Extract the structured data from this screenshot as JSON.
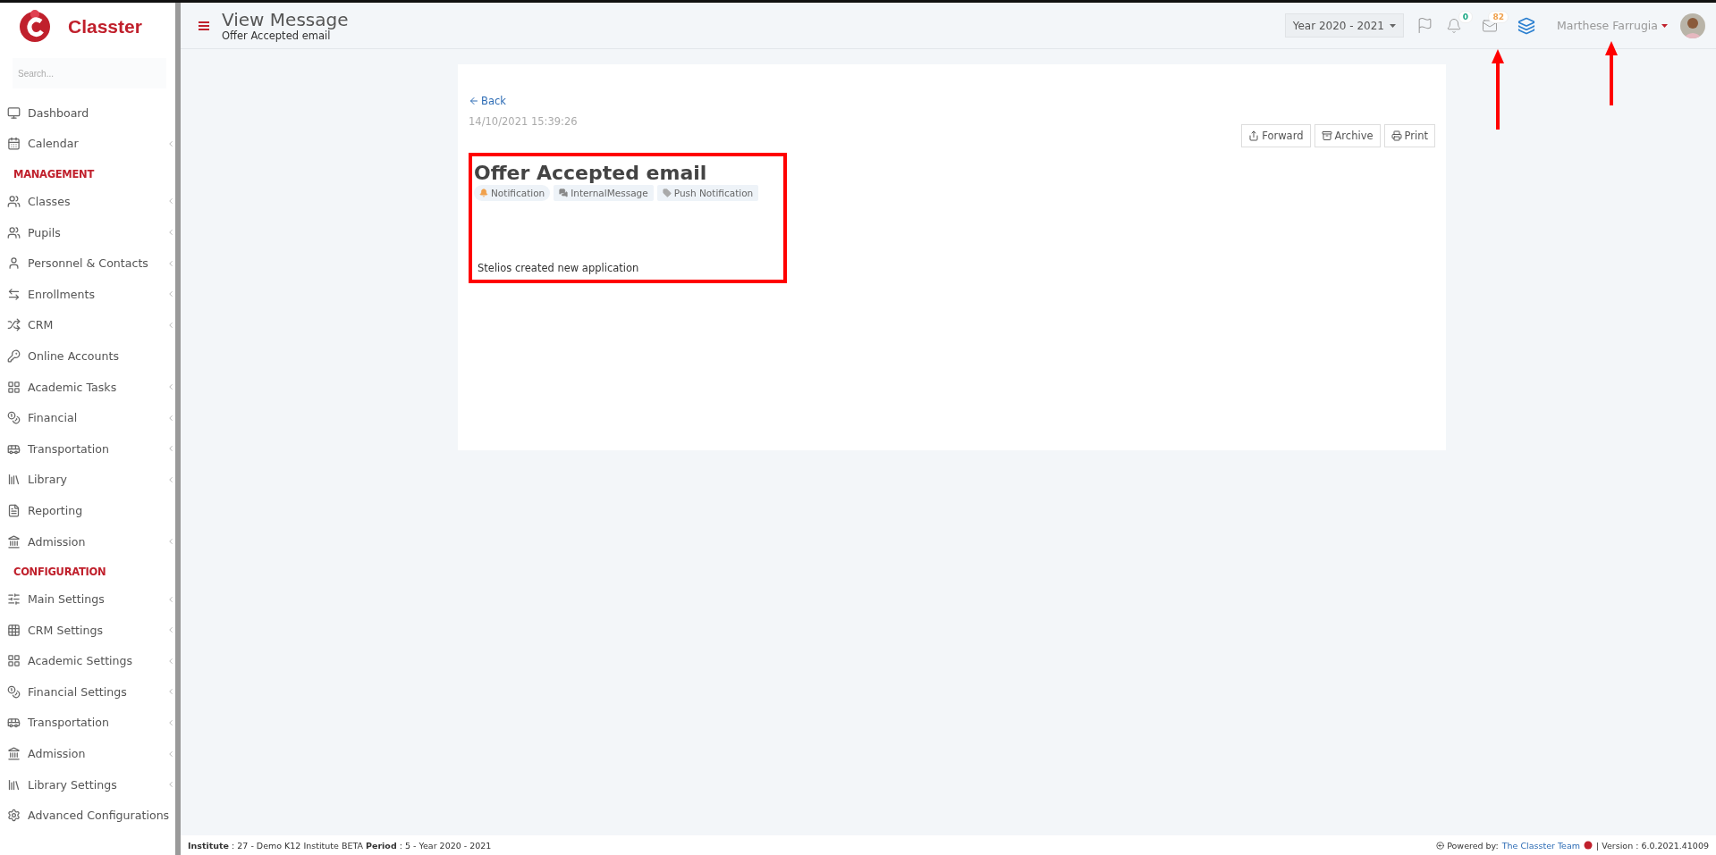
{
  "brand": {
    "name": "Classter"
  },
  "sidebar": {
    "search": {
      "placeholder": "Search..."
    },
    "sections": [
      {
        "items": [
          {
            "label": "Dashboard",
            "has_submenu": false
          },
          {
            "label": "Calendar",
            "has_submenu": true
          }
        ]
      },
      {
        "title": "MANAGEMENT",
        "items": [
          {
            "label": "Classes",
            "has_submenu": true
          },
          {
            "label": "Pupils",
            "has_submenu": true
          },
          {
            "label": "Personnel & Contacts",
            "has_submenu": true
          },
          {
            "label": "Enrollments",
            "has_submenu": true
          },
          {
            "label": "CRM",
            "has_submenu": true
          },
          {
            "label": "Online Accounts",
            "has_submenu": false
          },
          {
            "label": "Academic Tasks",
            "has_submenu": true
          },
          {
            "label": "Financial",
            "has_submenu": true
          },
          {
            "label": "Transportation",
            "has_submenu": true
          },
          {
            "label": "Library",
            "has_submenu": true
          },
          {
            "label": "Reporting",
            "has_submenu": false
          },
          {
            "label": "Admission",
            "has_submenu": true
          }
        ]
      },
      {
        "title": "CONFIGURATION",
        "items": [
          {
            "label": "Main Settings",
            "has_submenu": true
          },
          {
            "label": "CRM Settings",
            "has_submenu": true
          },
          {
            "label": "Academic Settings",
            "has_submenu": true
          },
          {
            "label": "Financial Settings",
            "has_submenu": true
          },
          {
            "label": "Transportation",
            "has_submenu": true
          },
          {
            "label": "Admission",
            "has_submenu": true
          },
          {
            "label": "Library Settings",
            "has_submenu": true
          },
          {
            "label": "Advanced Configurations",
            "has_submenu": false
          }
        ]
      }
    ]
  },
  "header": {
    "title": "View Message",
    "subtitle": "Offer Accepted email",
    "year": "Year 2020 - 2021",
    "notifications": {
      "count": "0",
      "color": "#1aa884"
    },
    "messages": {
      "count": "82",
      "color": "#f0a04b"
    },
    "user": "Marthese Farrugia"
  },
  "message": {
    "back": "Back",
    "date": "14/10/2021 15:39:26",
    "actions": [
      "Forward",
      "Archive",
      "Print"
    ],
    "title": "Offer Accepted email",
    "tags": [
      {
        "label": "Notification",
        "kind": "notification"
      },
      {
        "label": "InternalMessage",
        "kind": "internal"
      },
      {
        "label": "Push Notification",
        "kind": "push"
      }
    ],
    "body": "Stelios created new application",
    "highlighted": true
  },
  "footer": {
    "info": "**Institute** : 27 - Demo K12 Institute BETA **Period** : 5 - Year 2020 - 2021",
    "powered": "Powered by:",
    "team": "The Classter Team",
    "version": "| Version : 6.0.2021.41009"
  }
}
